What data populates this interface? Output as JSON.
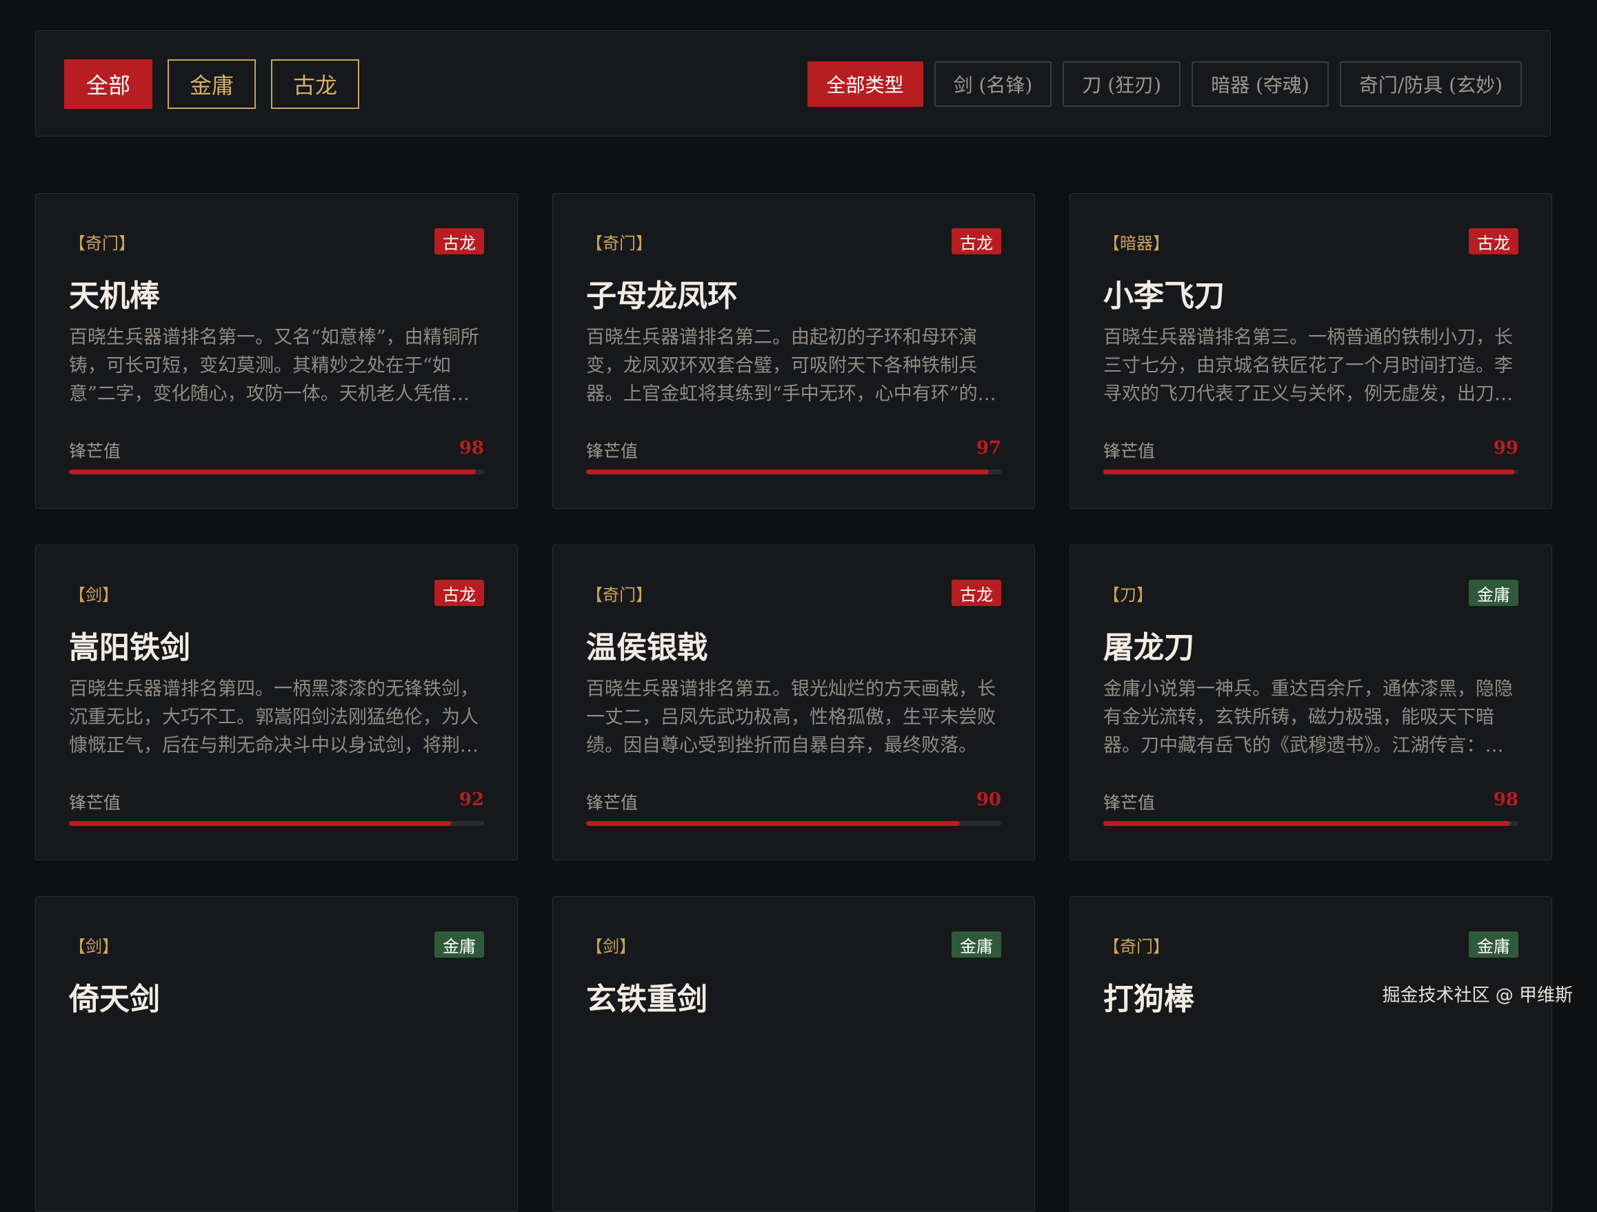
{
  "filters": {
    "sources": [
      {
        "label": "全部",
        "active": true
      },
      {
        "label": "金庸",
        "active": false
      },
      {
        "label": "古龙",
        "active": false
      }
    ],
    "types": [
      {
        "label": "全部类型",
        "active": true
      },
      {
        "label": "剑 (名锋)",
        "active": false
      },
      {
        "label": "刀 (狂刃)",
        "active": false
      },
      {
        "label": "暗器 (夺魂)",
        "active": false
      },
      {
        "label": "奇门/防具 (玄妙)",
        "active": false
      }
    ]
  },
  "colors": {
    "accent": "#b81d22",
    "gold": "#c9a45c",
    "gulong_badge": "#b81d22",
    "jinyong_badge": "#2f5a3a"
  },
  "sharpness_label": "锋芒值",
  "cards": [
    {
      "type": "【奇门】",
      "source": "古龙",
      "name": "天机棒",
      "desc": "百晓生兵器谱排名第一。又名“如意棒”，由精铜所铸，可长可短，变幻莫测。其精妙之处在于“如意”二字，变化随心，攻防一体。天机老人凭借此棒纵横天下。",
      "sharpness": "98"
    },
    {
      "type": "【奇门】",
      "source": "古龙",
      "name": "子母龙凤环",
      "desc": "百晓生兵器谱排名第二。由起初的子环和母环演变，龙凤双环双套合璧，可吸附天下各种铁制兵器。上官金虹将其练到“手中无环，心中有环”的境界。",
      "sharpness": "97"
    },
    {
      "type": "【暗器】",
      "source": "古龙",
      "name": "小李飞刀",
      "desc": "百晓生兵器谱排名第三。一柄普通的铁制小刀，长三寸七分，由京城名铁匠花了一个月时间打造。李寻欢的飞刀代表了正义与关怀，例无虚发，出刀必中。",
      "sharpness": "99"
    },
    {
      "type": "【剑】",
      "source": "古龙",
      "name": "嵩阳铁剑",
      "desc": "百晓生兵器谱排名第四。一柄黑漆漆的无锋铁剑，沉重无比，大巧不工。郭嵩阳剑法刚猛绝伦，为人慷慨正气，后在与荆无命决斗中以身试剑，将荆无命的剑法破绽示于众人。",
      "sharpness": "92"
    },
    {
      "type": "【奇门】",
      "source": "古龙",
      "name": "温侯银戟",
      "desc": "百晓生兵器谱排名第五。银光灿烂的方天画戟，长一丈二，吕凤先武功极高，性格孤傲，生平未尝败绩。因自尊心受到挫折而自暴自弃，最终败落。",
      "sharpness": "90"
    },
    {
      "type": "【刀】",
      "source": "金庸",
      "name": "屠龙刀",
      "desc": "金庸小说第一神兵。重达百余斤，通体漆黑，隐隐有金光流转，玄铁所铸，磁力极强，能吸天下暗器。刀中藏有岳飞的《武穆遗书》。江湖传言：武林至尊，宝刀屠龙。",
      "sharpness": "98"
    },
    {
      "type": "【剑】",
      "source": "金庸",
      "name": "倚天剑",
      "desc": "",
      "sharpness": ""
    },
    {
      "type": "【剑】",
      "source": "金庸",
      "name": "玄铁重剑",
      "desc": "",
      "sharpness": ""
    },
    {
      "type": "【奇门】",
      "source": "金庸",
      "name": "打狗棒",
      "desc": "",
      "sharpness": ""
    }
  ],
  "watermark": "掘金技术社区 @ 甲维斯"
}
